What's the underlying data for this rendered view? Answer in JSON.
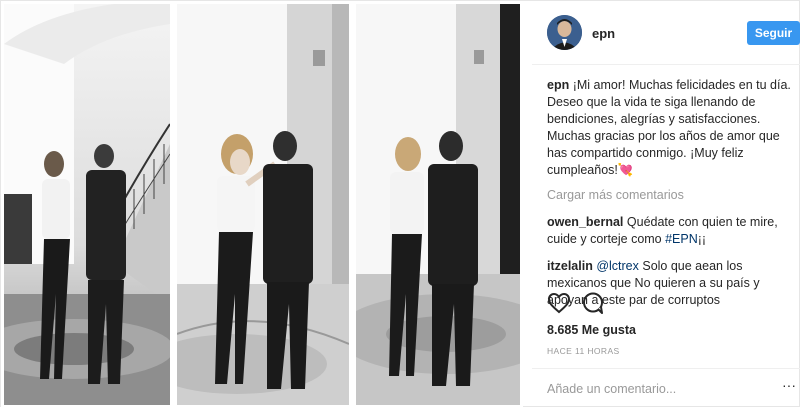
{
  "post": {
    "username": "epn",
    "follow_label": "Seguir",
    "caption": {
      "username": "epn",
      "text": "¡Mi amor! Muchas felicidades en tu día. Deseo que la vida te siga llenando de bendiciones, alegrías y satisfacciones. Muchas gracias por los años de amor que has compartido conmigo. ¡Muy feliz cumpleaños!💘"
    },
    "load_more": "Cargar más comentarios",
    "comments": [
      {
        "username": "owen_bernal",
        "text_before": "Quédate con quien te mire, cuide y corteje como ",
        "tag": "#EPN",
        "text_after": "¡¡"
      },
      {
        "username": "itzelalin",
        "tag": "@lctrex",
        "text": " Solo que aean los mexicanos que No quieren a su país y apoyan a este par de corruptos"
      }
    ],
    "likes": "8.685 Me gusta",
    "timestamp": "HACE 11 HORAS",
    "add_comment_placeholder": "Añade un comentario...",
    "more_options": "···",
    "icons": {
      "like": "heart-icon",
      "comment": "comment-icon"
    },
    "colors": {
      "follow_button": "#3897f0",
      "tag": "#003569",
      "muted": "#999999"
    }
  }
}
